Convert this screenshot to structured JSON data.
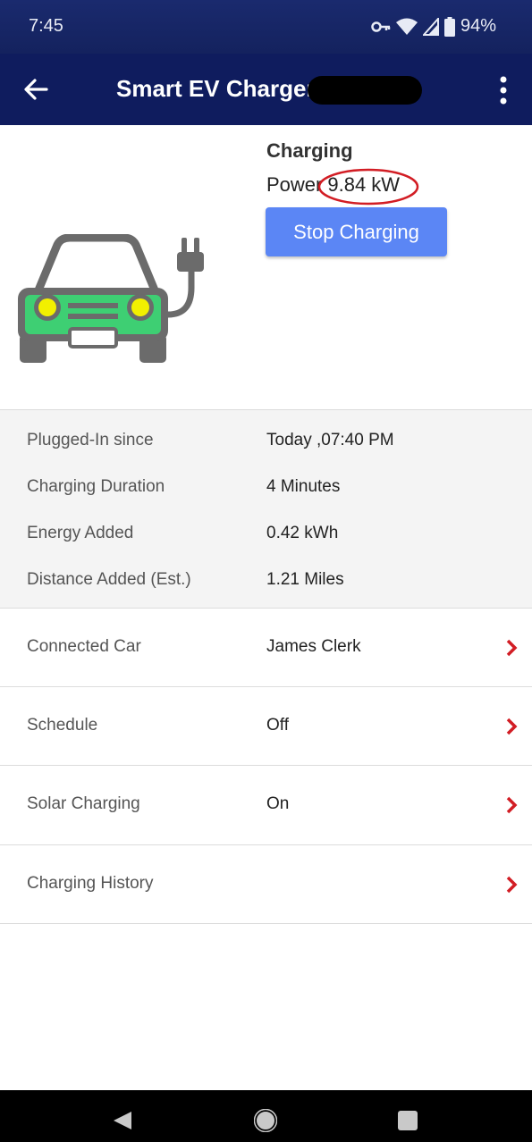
{
  "status_bar": {
    "time": "7:45",
    "battery": "94%",
    "icons": [
      "vpn-key-icon",
      "wifi-icon",
      "cell-signal-icon",
      "battery-icon"
    ]
  },
  "app_bar": {
    "title": "Smart EV Charger",
    "icons": [
      "back-arrow-icon",
      "more-vert-icon"
    ]
  },
  "charger": {
    "status": "Charging",
    "power_label": "Power",
    "power_value": "9.84 kW",
    "stop_button": "Stop Charging",
    "colors": {
      "button": "#5b86f5",
      "car_body": "#6b6b6b",
      "car_glow": "#3ecf73",
      "headlights": "#f2f000",
      "annotation": "#d21d24"
    }
  },
  "stats": [
    {
      "label": "Plugged-In since",
      "value": "Today ,07:40 PM"
    },
    {
      "label": "Charging Duration",
      "value": "4 Minutes"
    },
    {
      "label": "Energy Added",
      "value": "0.42 kWh"
    },
    {
      "label": "Distance Added (Est.)",
      "value": "1.21 Miles"
    }
  ],
  "nav_items": [
    {
      "label": "Connected Car",
      "value": "James Clerk",
      "icon": "chevron-right-icon"
    },
    {
      "label": "Schedule",
      "value": "Off",
      "icon": "chevron-right-icon"
    },
    {
      "label": "Solar Charging",
      "value": "On",
      "icon": "chevron-right-icon"
    },
    {
      "label": "Charging History",
      "value": "",
      "icon": "chevron-right-icon"
    }
  ],
  "system_nav": {
    "icons": [
      "nav-back-icon",
      "nav-home-icon",
      "nav-recents-icon"
    ]
  },
  "theme": {
    "header": "#0f1c5e",
    "status_bar": "#1a2a6e",
    "chevron": "#d21d24",
    "stats_bg": "#f4f4f4"
  }
}
